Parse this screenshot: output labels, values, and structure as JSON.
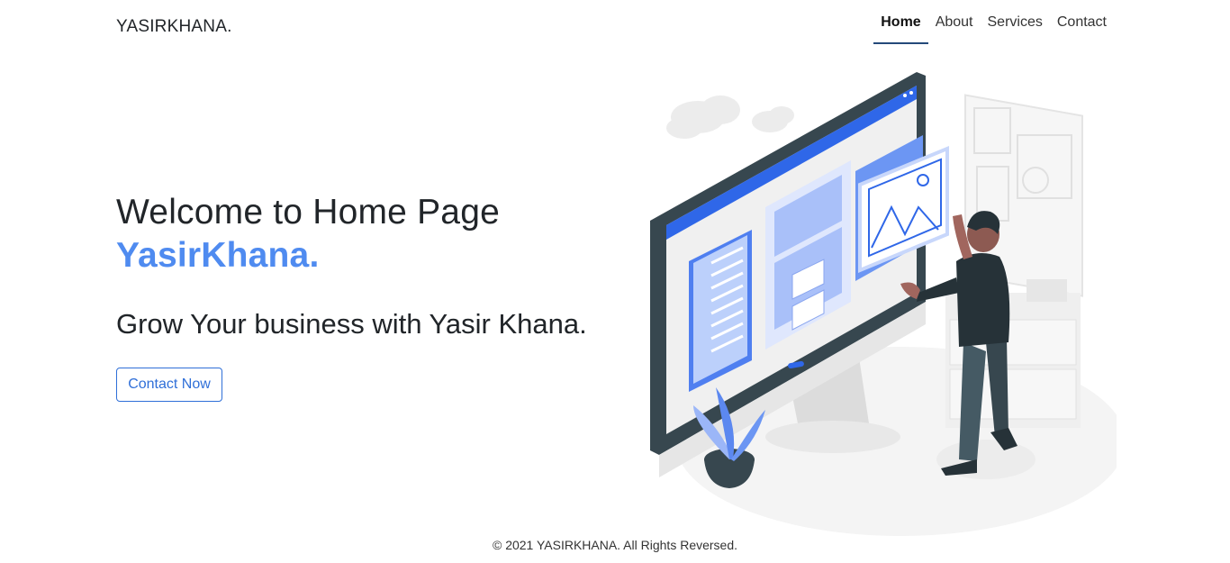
{
  "brand": "YASIRKHANA.",
  "nav": {
    "home": "Home",
    "about": "About",
    "services": "Services",
    "contact": "Contact"
  },
  "hero": {
    "title": "Welcome to Home Page",
    "name": "YasirKhana.",
    "subtitle": "Grow Your business with Yasir Khana.",
    "cta": "Contact Now"
  },
  "footer": "© 2021 YASIRKHANA. All Rights Reversed.",
  "colors": {
    "accent": "#4f8bf0",
    "button": "#2f6fd8",
    "nav_underline": "#244a7a",
    "screen_blue": "#2f67e8"
  },
  "illustration_icon": "person-at-monitor-illustration"
}
